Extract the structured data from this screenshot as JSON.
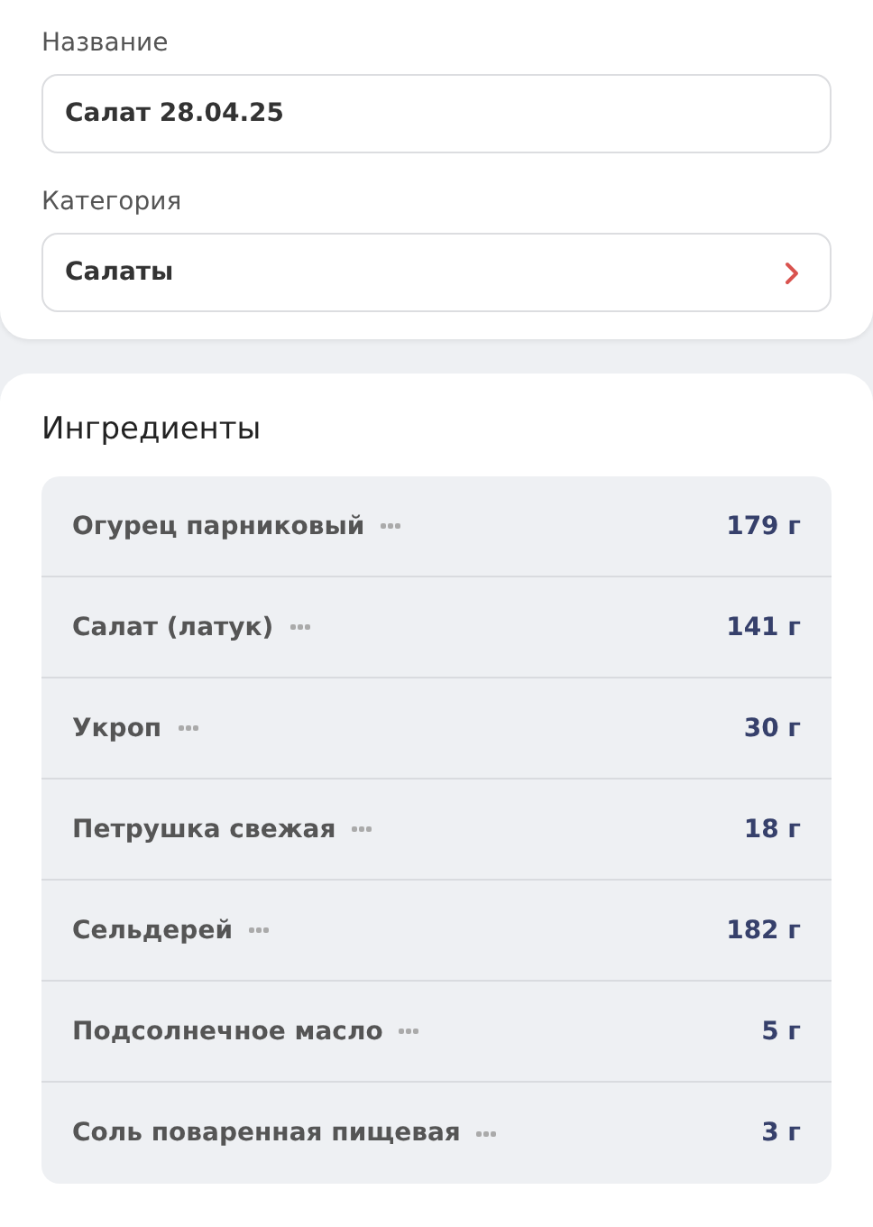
{
  "details": {
    "fields": [
      {
        "label": "Название",
        "value": "Салат 28.04.25",
        "kind": "text"
      },
      {
        "label": "Категория",
        "value": "Салаты",
        "kind": "picker"
      }
    ]
  },
  "ingredients": {
    "title": "Ингредиенты",
    "items": [
      {
        "name": "Огурец парниковый",
        "amount": "179 г"
      },
      {
        "name": "Салат (латук)",
        "amount": "141 г"
      },
      {
        "name": "Укроп",
        "amount": "30 г"
      },
      {
        "name": "Петрушка свежая",
        "amount": "18 г"
      },
      {
        "name": "Сельдерей",
        "amount": "182 г"
      },
      {
        "name": "Подсолнечное масло",
        "amount": "5 г"
      },
      {
        "name": "Соль поваренная пищевая",
        "amount": "3 г"
      }
    ]
  }
}
